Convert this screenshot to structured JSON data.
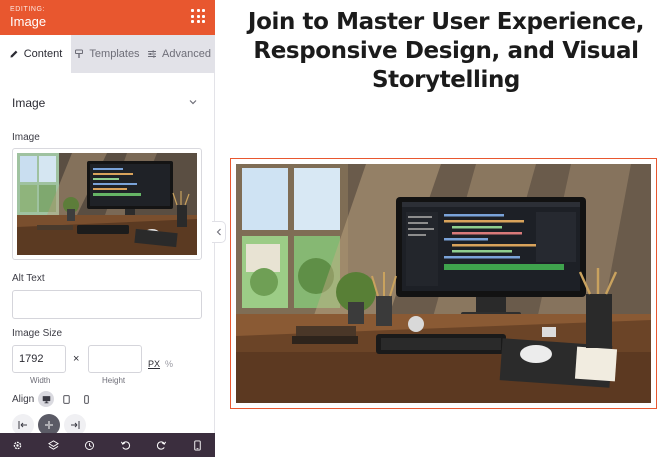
{
  "panel": {
    "editing_label": "EDITING:",
    "title": "Image",
    "tabs": [
      {
        "label": "Content",
        "active": true
      },
      {
        "label": "Templates",
        "active": false
      },
      {
        "label": "Advanced",
        "active": false
      }
    ],
    "section_title": "Image",
    "image_label": "Image",
    "alt_text_label": "Alt Text",
    "alt_text_value": "",
    "image_size_label": "Image Size",
    "width_value": "1792",
    "height_value": "",
    "times_symbol": "×",
    "unit_px": "PX",
    "unit_percent": "%",
    "width_sublabel": "Width",
    "height_sublabel": "Height",
    "align_label": "Align",
    "selected_alignment": "center"
  },
  "content": {
    "headline": "Join to Master User Experience, Responsive Design, and Visual Storytelling"
  },
  "colors": {
    "accent": "#e8572f",
    "bottom_bar": "#3b2e3e",
    "tab_bar": "#e2e2e8"
  },
  "icons": {
    "header_menu": "grid-dots-icon",
    "bottom_bar": [
      "settings-icon",
      "layers-icon",
      "history-icon",
      "undo-icon",
      "redo-icon",
      "responsive-preview-icon"
    ]
  }
}
